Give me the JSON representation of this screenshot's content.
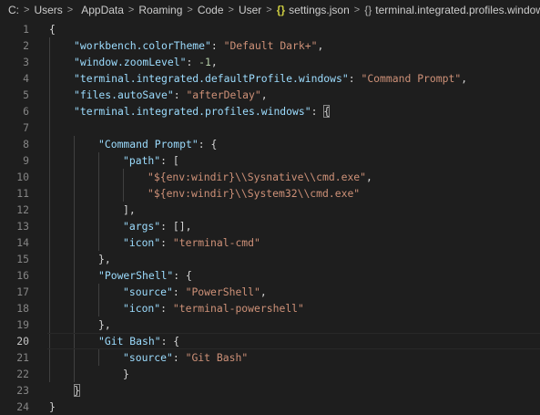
{
  "breadcrumb": {
    "items": [
      {
        "label": "C:"
      },
      {
        "label": "Users"
      },
      {
        "label": "AppData"
      },
      {
        "label": "Roaming"
      },
      {
        "label": "Code"
      },
      {
        "label": "User"
      },
      {
        "label": "settings.json",
        "icon": "json-braces-icon"
      },
      {
        "label": "terminal.integrated.profiles.windows",
        "icon": "object-braces-icon"
      }
    ],
    "separator": ">",
    "json_icon_glyph": "{}",
    "obj_icon_glyph": "{}"
  },
  "editor": {
    "active_line": 20,
    "line_numbers": [
      "1",
      "2",
      "3",
      "4",
      "5",
      "6",
      "7",
      "8",
      "9",
      "10",
      "11",
      "12",
      "13",
      "14",
      "15",
      "16",
      "17",
      "18",
      "19",
      "20",
      "21",
      "22",
      "23",
      "24"
    ],
    "lines": [
      [
        {
          "t": "punc",
          "v": "{"
        }
      ],
      [
        {
          "t": "key",
          "v": "\"workbench.colorTheme\""
        },
        {
          "t": "punc",
          "v": ": "
        },
        {
          "t": "str",
          "v": "\"Default Dark+\""
        },
        {
          "t": "punc",
          "v": ","
        }
      ],
      [
        {
          "t": "key",
          "v": "\"window.zoomLevel\""
        },
        {
          "t": "punc",
          "v": ": "
        },
        {
          "t": "num",
          "v": "-1"
        },
        {
          "t": "punc",
          "v": ","
        }
      ],
      [
        {
          "t": "key",
          "v": "\"terminal.integrated.defaultProfile.windows\""
        },
        {
          "t": "punc",
          "v": ": "
        },
        {
          "t": "str",
          "v": "\"Command Prompt\""
        },
        {
          "t": "punc",
          "v": ","
        }
      ],
      [
        {
          "t": "key",
          "v": "\"files.autoSave\""
        },
        {
          "t": "punc",
          "v": ": "
        },
        {
          "t": "str",
          "v": "\"afterDelay\""
        },
        {
          "t": "punc",
          "v": ","
        }
      ],
      [
        {
          "t": "key",
          "v": "\"terminal.integrated.profiles.windows\""
        },
        {
          "t": "punc",
          "v": ": "
        },
        {
          "t": "brace",
          "v": "{"
        }
      ],
      [],
      [
        {
          "t": "key",
          "v": "\"Command Prompt\""
        },
        {
          "t": "punc",
          "v": ": {"
        }
      ],
      [
        {
          "t": "key",
          "v": "\"path\""
        },
        {
          "t": "punc",
          "v": ": ["
        }
      ],
      [
        {
          "t": "str",
          "v": "\"${env:windir}\\\\Sysnative\\\\cmd.exe\""
        },
        {
          "t": "punc",
          "v": ","
        }
      ],
      [
        {
          "t": "str",
          "v": "\"${env:windir}\\\\System32\\\\cmd.exe\""
        }
      ],
      [
        {
          "t": "punc",
          "v": "],"
        }
      ],
      [
        {
          "t": "key",
          "v": "\"args\""
        },
        {
          "t": "punc",
          "v": ": [],"
        }
      ],
      [
        {
          "t": "key",
          "v": "\"icon\""
        },
        {
          "t": "punc",
          "v": ": "
        },
        {
          "t": "str",
          "v": "\"terminal-cmd\""
        }
      ],
      [
        {
          "t": "punc",
          "v": "},"
        }
      ],
      [
        {
          "t": "key",
          "v": "\"PowerShell\""
        },
        {
          "t": "punc",
          "v": ": {"
        }
      ],
      [
        {
          "t": "key",
          "v": "\"source\""
        },
        {
          "t": "punc",
          "v": ": "
        },
        {
          "t": "str",
          "v": "\"PowerShell\""
        },
        {
          "t": "punc",
          "v": ","
        }
      ],
      [
        {
          "t": "key",
          "v": "\"icon\""
        },
        {
          "t": "punc",
          "v": ": "
        },
        {
          "t": "str",
          "v": "\"terminal-powershell\""
        }
      ],
      [
        {
          "t": "punc",
          "v": "},"
        }
      ],
      [
        {
          "t": "key",
          "v": "\"Git Bash\""
        },
        {
          "t": "punc",
          "v": ": {"
        }
      ],
      [
        {
          "t": "key",
          "v": "\"source\""
        },
        {
          "t": "punc",
          "v": ": "
        },
        {
          "t": "str",
          "v": "\"Git Bash\""
        }
      ],
      [
        {
          "t": "punc",
          "v": "}"
        }
      ],
      [
        {
          "t": "brace",
          "v": "}"
        }
      ],
      [
        {
          "t": "punc",
          "v": "}"
        }
      ]
    ],
    "indent": [
      0,
      1,
      1,
      1,
      1,
      1,
      0,
      2,
      3,
      4,
      4,
      3,
      3,
      3,
      2,
      2,
      3,
      3,
      2,
      2,
      3,
      3,
      1,
      0
    ]
  },
  "colors": {
    "background": "#1e1e1e",
    "key": "#9cdcfe",
    "string": "#ce9178",
    "number": "#b5cea8",
    "punctuation": "#d4d4d4",
    "line_number": "#858585"
  }
}
